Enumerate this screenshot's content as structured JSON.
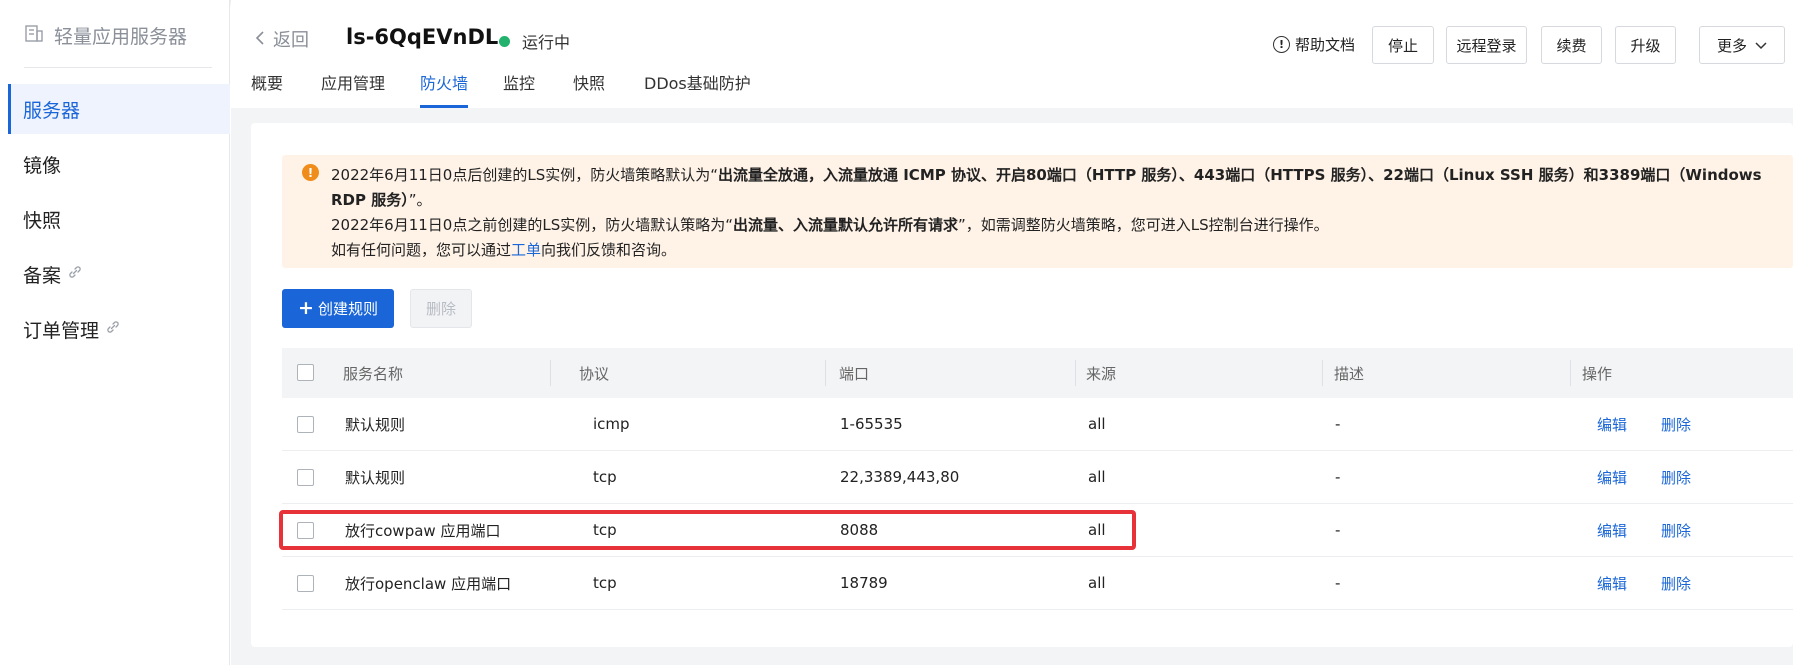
{
  "sidebar": {
    "brand": "轻量应用服务器",
    "items": [
      {
        "label": "服务器",
        "active": true,
        "external": false
      },
      {
        "label": "镜像",
        "active": false,
        "external": false
      },
      {
        "label": "快照",
        "active": false,
        "external": false
      },
      {
        "label": "备案",
        "active": false,
        "external": true
      },
      {
        "label": "订单管理",
        "active": false,
        "external": true
      }
    ]
  },
  "header": {
    "back_label": "返回",
    "instance_name": "ls-6QqEVnDL",
    "status_text": "运行中",
    "help_label": "帮助文档",
    "buttons": {
      "stop": "停止",
      "remote_login": "远程登录",
      "renew": "续费",
      "upgrade": "升级",
      "more": "更多"
    },
    "tabs": [
      {
        "label": "概要",
        "active": false
      },
      {
        "label": "应用管理",
        "active": false
      },
      {
        "label": "防火墙",
        "active": true
      },
      {
        "label": "监控",
        "active": false
      },
      {
        "label": "快照",
        "active": false
      },
      {
        "label": "DDos基础防护",
        "active": false
      }
    ]
  },
  "notice": {
    "line1_prefix": "2022年6月11日0点后创建的LS实例，防火墙策略默认为“",
    "line1_bold": "出流量全放通，入流量放通 ICMP 协议、开启80端口（HTTP 服务）、443端口（HTTPS 服务）、22端口（Linux SSH 服务）和3389端口（Windows RDP 服务）",
    "line1_suffix": "”。",
    "line2_prefix": "2022年6月11日0点之前创建的LS实例，防火墙默认策略为“",
    "line2_bold": "出流量、入流量默认允许所有请求",
    "line2_suffix": "”，如需调整防火墙策略，您可进入LS控制台进行操作。",
    "line3_prefix": "如有任何问题，您可以通过",
    "line3_link": "工单",
    "line3_suffix": "向我们反馈和咨询。"
  },
  "toolbar": {
    "create_label": "创建规则",
    "delete_label": "删除"
  },
  "table": {
    "columns": [
      "服务名称",
      "协议",
      "端口",
      "来源",
      "描述",
      "操作"
    ],
    "edit_label": "编辑",
    "delete_label": "删除",
    "rows": [
      {
        "name": "默认规则",
        "protocol": "icmp",
        "port": "1-65535",
        "source": "all",
        "desc": "-",
        "highlighted": false
      },
      {
        "name": "默认规则",
        "protocol": "tcp",
        "port": "22,3389,443,80",
        "source": "all",
        "desc": "-",
        "highlighted": false
      },
      {
        "name": "放行cowpaw 应用端口",
        "protocol": "tcp",
        "port": "8088",
        "source": "all",
        "desc": "-",
        "highlighted": true
      },
      {
        "name": "放行openclaw 应用端口",
        "protocol": "tcp",
        "port": "18789",
        "source": "all",
        "desc": "-",
        "highlighted": false
      }
    ]
  },
  "colors": {
    "primary": "#1a66d8",
    "running": "#23b26d",
    "warning": "#f08c1a",
    "notice_bg": "#fff3e8",
    "highlight": "#e8323a"
  }
}
